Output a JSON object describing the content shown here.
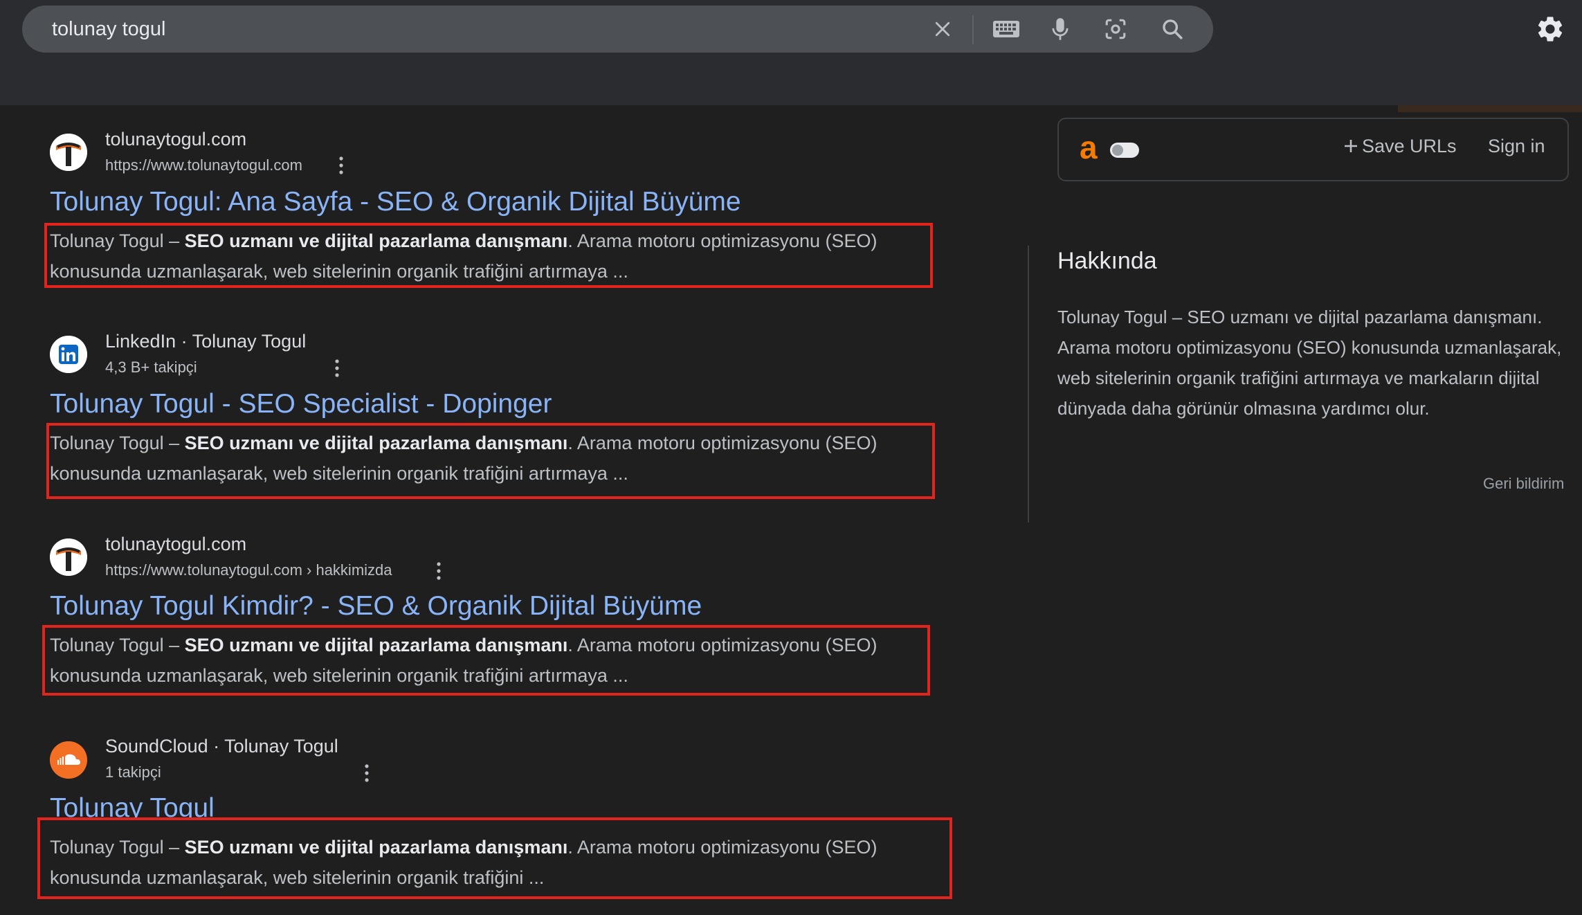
{
  "search": {
    "query": "tolunay togul",
    "clear_icon": "close-icon",
    "keyboard_icon": "keyboard-icon",
    "voice_icon": "microphone-icon",
    "lens_icon": "camera-lens-icon",
    "search_icon": "search-icon"
  },
  "settings_icon": "gear-icon",
  "results": [
    {
      "site_name": "tolunaytogul.com",
      "url": "https://www.tolunaytogul.com",
      "title": "Tolunay Togul: Ana Sayfa - SEO & Organik Dijital Büyüme",
      "snippet_prefix": "Tolunay Togul – ",
      "snippet_bold": "SEO uzmanı ve dijital pazarlama danışmanı",
      "snippet_rest": ". Arama motoru optimizasyonu (SEO) konusunda uzmanlaşarak, web sitelerinin organik trafiğini artırmaya ..."
    },
    {
      "site_name": "LinkedIn · Tolunay Togul",
      "url": "4,3 B+ takipçi",
      "title": "Tolunay Togul - SEO Specialist - Dopinger",
      "snippet_prefix": "Tolunay Togul – ",
      "snippet_bold": "SEO uzmanı ve dijital pazarlama danışmanı",
      "snippet_rest": ". Arama motoru optimizasyonu (SEO) konusunda uzmanlaşarak, web sitelerinin organik trafiğini artırmaya ..."
    },
    {
      "site_name": "tolunaytogul.com",
      "url": "https://www.tolunaytogul.com › hakkimizda",
      "title": "Tolunay Togul Kimdir? - SEO & Organik Dijital Büyüme",
      "snippet_prefix": "Tolunay Togul – ",
      "snippet_bold": "SEO uzmanı ve dijital pazarlama danışmanı",
      "snippet_rest": ". Arama motoru optimizasyonu (SEO) konusunda uzmanlaşarak, web sitelerinin organik trafiğini artırmaya ..."
    },
    {
      "site_name": "SoundCloud · Tolunay Togul",
      "url": "1 takipçi",
      "title": "Tolunay Togul",
      "snippet_prefix": "Tolunay Togul – ",
      "snippet_bold": "SEO uzmanı ve dijital pazarlama danışmanı",
      "snippet_rest": ". Arama motoru optimizasyonu (SEO) konusunda uzmanlaşarak, web sitelerinin organik trafiğini ..."
    }
  ],
  "extension": {
    "logo": "a",
    "save_urls": "Save URLs",
    "plus_icon": "plus-icon",
    "sign_in": "Sign in"
  },
  "about": {
    "heading": "Hakkında",
    "text": "Tolunay Togul – SEO uzmanı ve dijital pazarlama danışmanı. Arama motoru optimizasyonu (SEO) konusunda uzmanlaşarak, web sitelerinin organik trafiğini artırmaya ve markaların dijital dünyada daha görünür olmasına yardımcı olur.",
    "feedback": "Geri bildirim"
  },
  "colors": {
    "background": "#1f1f1f",
    "link": "#8ab4f8",
    "highlight_box": "#e3241c",
    "extension_accent": "#f57c00"
  }
}
